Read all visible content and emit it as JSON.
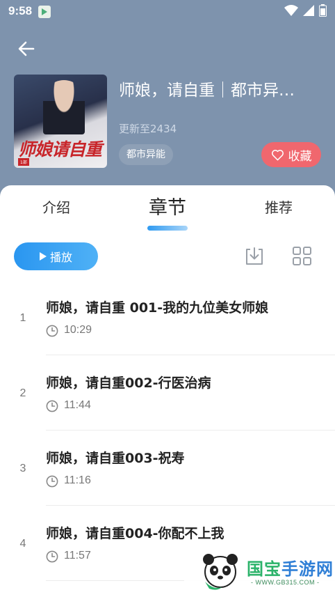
{
  "status": {
    "time": "9:58"
  },
  "book": {
    "title": "师娘，请自重｜都市异…",
    "cover_title": "师娘请自重",
    "cover_tag": "1部",
    "update": "更新至2434",
    "genre": "都市异能",
    "favorite_label": "收藏"
  },
  "tabs": [
    {
      "label": "介绍"
    },
    {
      "label": "章节"
    },
    {
      "label": "推荐"
    }
  ],
  "active_tab": "章节",
  "toolbar": {
    "play_label": "播放"
  },
  "chapters": [
    {
      "num": "1",
      "title": "师娘，请自重 001-我的九位美女师娘",
      "duration": "10:29"
    },
    {
      "num": "2",
      "title": "师娘，请自重002-行医治病",
      "duration": "11:44"
    },
    {
      "num": "3",
      "title": "师娘，请自重003-祝寿",
      "duration": "11:16"
    },
    {
      "num": "4",
      "title": "师娘，请自重004-你配不上我",
      "duration": "11:57"
    }
  ],
  "watermark": {
    "name_a": "国宝",
    "name_b": "手游网",
    "url": "- WWW.GB315.COM -"
  },
  "colors": {
    "header": "#7e93ad",
    "accent": "#2a96f0",
    "favorite": "#f0676e"
  },
  "icons": [
    "back-arrow-icon",
    "heart-icon",
    "play-icon",
    "download-icon",
    "grid-icon",
    "clock-icon",
    "wifi-icon",
    "signal-icon",
    "battery-icon"
  ]
}
